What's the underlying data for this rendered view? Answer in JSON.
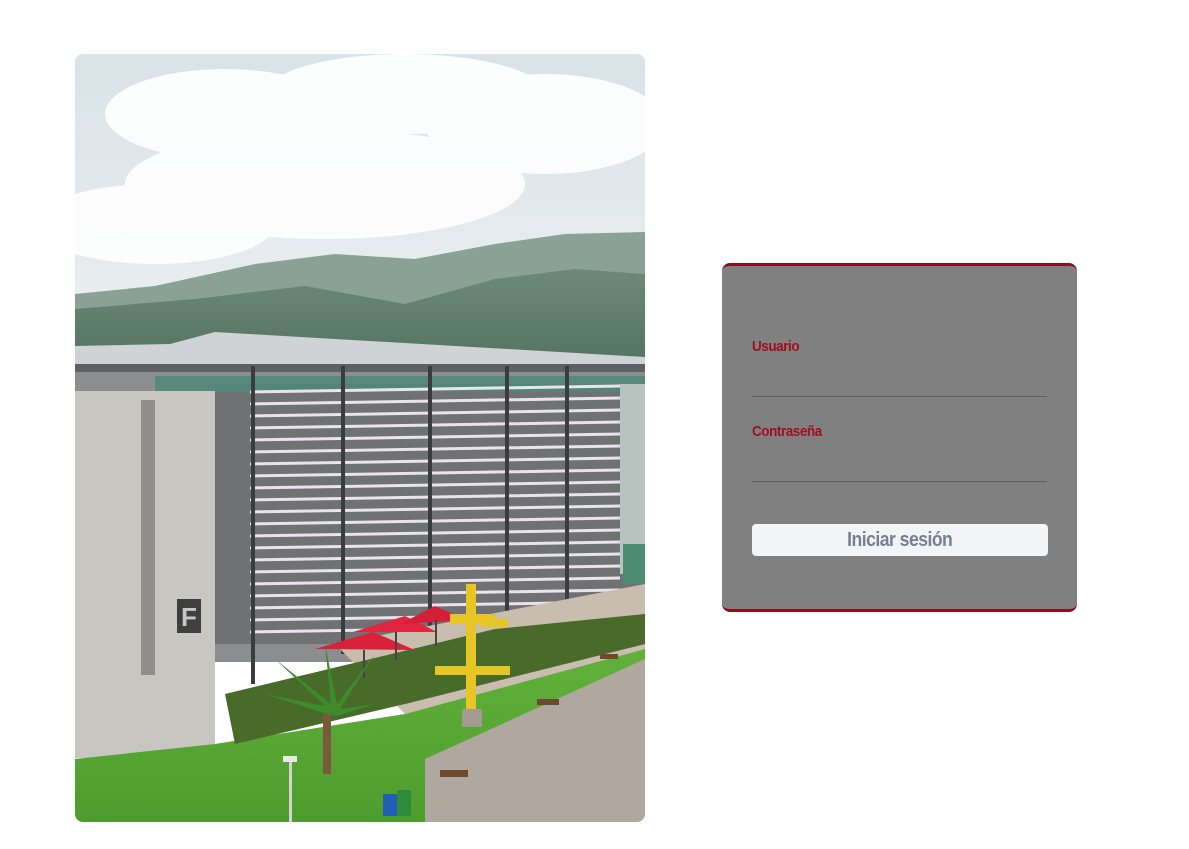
{
  "login": {
    "username_label": "Usuario",
    "username_value": "",
    "password_label": "Contraseña",
    "password_value": "",
    "submit_label": "Iniciar sesión"
  },
  "colors": {
    "card_background": "#808080",
    "accent_red": "#a30d1e",
    "button_background": "#f3f4f6",
    "button_text": "#767f93"
  },
  "image": {
    "building_sign": "F"
  }
}
